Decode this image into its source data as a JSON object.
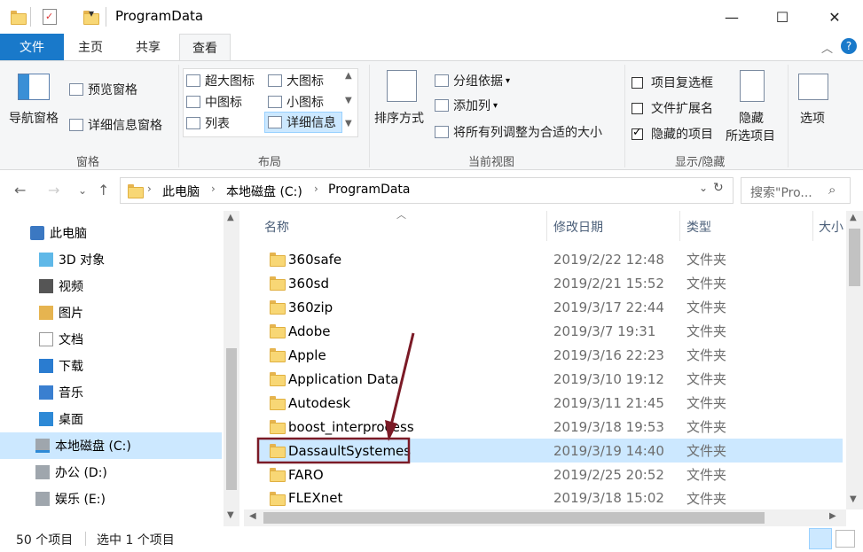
{
  "window": {
    "title": "ProgramData",
    "qat_dropdown": "▾",
    "min": "—",
    "max": "☐",
    "close": "✕"
  },
  "tabs": {
    "file": "文件",
    "home": "主页",
    "share": "共享",
    "view": "查看"
  },
  "ribbon": {
    "panes": {
      "nav_pane": "导航窗格",
      "preview_pane": "预览窗格",
      "details_pane": "详细信息窗格",
      "label": "窗格"
    },
    "layout": {
      "extra_large": "超大图标",
      "large": "大图标",
      "medium": "中图标",
      "small": "小图标",
      "list": "列表",
      "details": "详细信息",
      "label": "布局"
    },
    "current_view": {
      "sort_by": "排序方式",
      "group_by": "分组依据",
      "add_columns": "添加列",
      "size_all": "将所有列调整为合适的大小",
      "label": "当前视图"
    },
    "show_hide": {
      "item_checkboxes": "项目复选框",
      "file_extensions": "文件扩展名",
      "hidden_items": "隐藏的项目",
      "hide_selected_1": "隐藏",
      "hide_selected_2": "所选项目",
      "options": "选项",
      "label": "显示/隐藏",
      "item_checkboxes_checked": false,
      "file_extensions_checked": false,
      "hidden_items_checked": true
    }
  },
  "address": {
    "crumbs": [
      "此电脑",
      "本地磁盘 (C:)",
      "ProgramData"
    ],
    "search_placeholder": "搜索\"Pro..."
  },
  "nav": {
    "items": [
      {
        "label": "此电脑",
        "icon": "pc-icon"
      },
      {
        "label": "3D 对象",
        "icon": "3d-objects-icon"
      },
      {
        "label": "视频",
        "icon": "video-icon"
      },
      {
        "label": "图片",
        "icon": "pictures-icon"
      },
      {
        "label": "文档",
        "icon": "documents-icon"
      },
      {
        "label": "下载",
        "icon": "downloads-icon"
      },
      {
        "label": "音乐",
        "icon": "music-icon"
      },
      {
        "label": "桌面",
        "icon": "desktop-icon"
      },
      {
        "label": "本地磁盘 (C:)",
        "icon": "drive-c-icon"
      },
      {
        "label": "办公 (D:)",
        "icon": "drive-icon"
      },
      {
        "label": "娱乐 (E:)",
        "icon": "drive-icon"
      }
    ]
  },
  "columns": {
    "name": "名称",
    "date": "修改日期",
    "type": "类型",
    "size": "大小"
  },
  "files": [
    {
      "name": "360safe",
      "date": "2019/2/22 12:48",
      "type": "文件夹"
    },
    {
      "name": "360sd",
      "date": "2019/2/21 15:52",
      "type": "文件夹"
    },
    {
      "name": "360zip",
      "date": "2019/3/17 22:44",
      "type": "文件夹"
    },
    {
      "name": "Adobe",
      "date": "2019/3/7 19:31",
      "type": "文件夹"
    },
    {
      "name": "Apple",
      "date": "2019/3/16 22:23",
      "type": "文件夹"
    },
    {
      "name": "Application Data",
      "date": "2019/3/10 19:12",
      "type": "文件夹"
    },
    {
      "name": "Autodesk",
      "date": "2019/3/11 21:45",
      "type": "文件夹"
    },
    {
      "name": "boost_interprocess",
      "date": "2019/3/18 19:53",
      "type": "文件夹"
    },
    {
      "name": "DassaultSystemes",
      "date": "2019/3/19 14:40",
      "type": "文件夹"
    },
    {
      "name": "FARO",
      "date": "2019/2/25 20:52",
      "type": "文件夹"
    },
    {
      "name": "FLEXnet",
      "date": "2019/3/18 15:02",
      "type": "文件夹"
    }
  ],
  "status": {
    "count": "50 个项目",
    "selected": "选中 1 个项目"
  },
  "colors": {
    "accent": "#1979ca",
    "selection": "#cce8ff",
    "annotation": "#7b1a26"
  }
}
